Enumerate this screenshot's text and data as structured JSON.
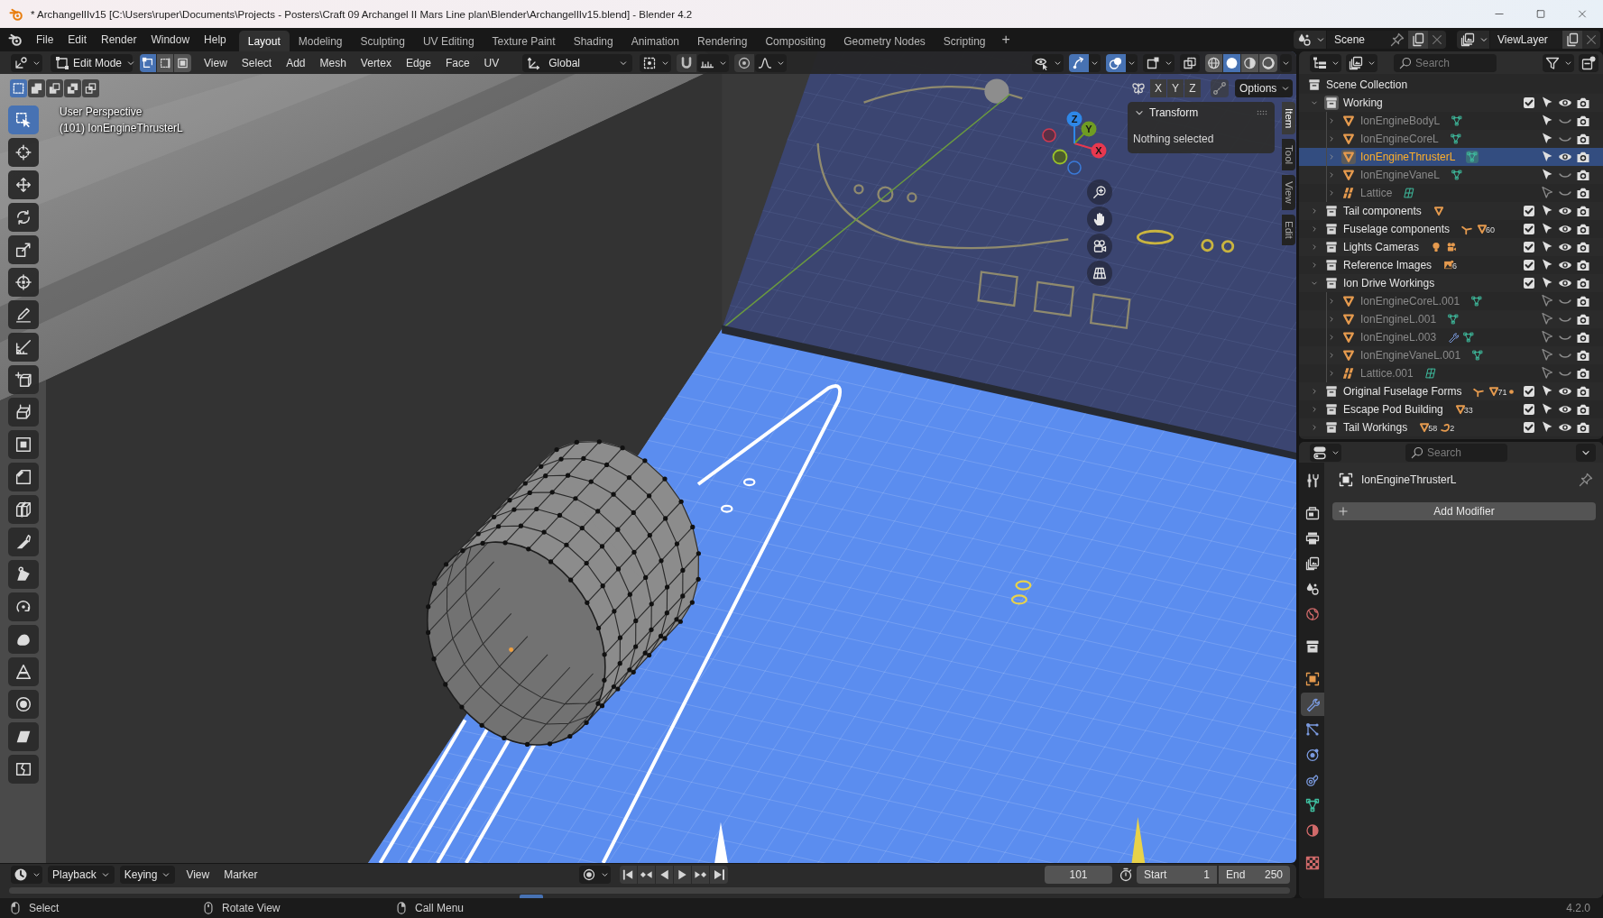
{
  "window": {
    "title": "* ArchangelIIv15 [C:\\Users\\ruper\\Documents\\Projects - Posters\\Craft 09 Archangel II Mars Line plan\\Blender\\ArchangelIIv15.blend] - Blender 4.2"
  },
  "top_bar": {
    "menu": [
      "File",
      "Edit",
      "Render",
      "Window",
      "Help"
    ],
    "workspaces": [
      {
        "label": "Layout",
        "selected": true
      },
      {
        "label": "Modeling",
        "selected": false
      },
      {
        "label": "Sculpting",
        "selected": false
      },
      {
        "label": "UV Editing",
        "selected": false
      },
      {
        "label": "Texture Paint",
        "selected": false
      },
      {
        "label": "Shading",
        "selected": false
      },
      {
        "label": "Animation",
        "selected": false
      },
      {
        "label": "Rendering",
        "selected": false
      },
      {
        "label": "Compositing",
        "selected": false
      },
      {
        "label": "Geometry Nodes",
        "selected": false
      },
      {
        "label": "Scripting",
        "selected": false
      }
    ],
    "add_workspace": "+",
    "scene": "Scene",
    "view_layer": "ViewLayer"
  },
  "viewport": {
    "header": {
      "mode": "Edit Mode",
      "select_modes": [
        {
          "kind": "vertex",
          "selected": true
        },
        {
          "kind": "edge",
          "selected": false
        },
        {
          "kind": "face",
          "selected": false
        }
      ],
      "menus": [
        "View",
        "Select",
        "Add",
        "Mesh",
        "Vertex",
        "Edge",
        "Face",
        "UV"
      ],
      "orientation": "Global",
      "snapping": {
        "on": false
      },
      "proportional_editing": {
        "on": false
      },
      "display_toggles": [
        {
          "kind": "visibility",
          "on": false
        },
        {
          "kind": "gizmo",
          "on": true
        },
        {
          "kind": "overlay",
          "on": true
        },
        {
          "kind": "mesh-overlay",
          "on": false
        },
        {
          "kind": "xray",
          "on": false
        }
      ],
      "shading": [
        {
          "kind": "wireframe",
          "selected": false
        },
        {
          "kind": "solid",
          "selected": true
        },
        {
          "kind": "material",
          "selected": false
        },
        {
          "kind": "rendered",
          "selected": false
        }
      ]
    },
    "select_box_modes": [
      {
        "kind": "set",
        "selected": true
      },
      {
        "kind": "extend",
        "selected": false
      },
      {
        "kind": "subtract",
        "selected": false
      },
      {
        "kind": "invert",
        "selected": false
      },
      {
        "kind": "intersect",
        "selected": false
      }
    ],
    "mirror_axes": [
      {
        "label": "X",
        "on": false
      },
      {
        "label": "Y",
        "on": false
      },
      {
        "label": "Z",
        "on": false
      }
    ],
    "options": "Options",
    "info": {
      "view": "User Perspective",
      "object": "(101) IonEngineThrusterL"
    },
    "toolbar": [
      {
        "kind": "select-box",
        "selected": true
      },
      {
        "kind": "cursor",
        "selected": false
      },
      {
        "kind": "move",
        "selected": false
      },
      {
        "kind": "rotate",
        "selected": false
      },
      {
        "kind": "scale",
        "selected": false
      },
      {
        "kind": "transform",
        "selected": false
      },
      {
        "kind": "annotate",
        "selected": false
      },
      {
        "kind": "measure",
        "selected": false
      },
      {
        "kind": "add-cube",
        "selected": false
      },
      {
        "kind": "extrude",
        "selected": false
      },
      {
        "kind": "inset",
        "selected": false
      },
      {
        "kind": "bevel",
        "selected": false
      },
      {
        "kind": "loop-cut",
        "selected": false
      },
      {
        "kind": "knife",
        "selected": false
      },
      {
        "kind": "poly-build",
        "selected": false
      },
      {
        "kind": "spin",
        "selected": false
      },
      {
        "kind": "smooth",
        "selected": false
      },
      {
        "kind": "edge-slide",
        "selected": false
      },
      {
        "kind": "shrink-fatten",
        "selected": false
      },
      {
        "kind": "shear",
        "selected": false
      },
      {
        "kind": "rip",
        "selected": false
      }
    ],
    "nav_gizmo": {
      "axes": [
        "X",
        "Y",
        "Z"
      ]
    },
    "sidebar": {
      "tabs": [
        {
          "label": "Item",
          "selected": true
        },
        {
          "label": "Tool",
          "selected": false
        },
        {
          "label": "View",
          "selected": false
        },
        {
          "label": "Edit",
          "selected": false
        }
      ],
      "panel": {
        "title": "Transform",
        "expanded": true,
        "message": "Nothing selected"
      }
    }
  },
  "outliner": {
    "search": {
      "placeholder": "Search"
    },
    "tree": {
      "name": "Scene Collection",
      "children": [
        {
          "name": "Working",
          "expanded": true,
          "active": true,
          "checked": true,
          "selectable": true,
          "visible": true,
          "selected": false,
          "children": [
            {
              "name": "IonEngineBodyL",
              "kind": "mesh",
              "expanded": false,
              "selectable": true,
              "visible": false,
              "selected": false,
              "data": [
                {
                  "kind": "mesh-data"
                }
              ]
            },
            {
              "name": "IonEngineCoreL",
              "kind": "mesh",
              "expanded": false,
              "selectable": true,
              "visible": false,
              "selected": false,
              "data": [
                {
                  "kind": "mesh-data"
                }
              ]
            },
            {
              "name": "IonEngineThrusterL",
              "kind": "mesh",
              "expanded": false,
              "selectable": true,
              "visible": true,
              "selected": true,
              "data": [
                {
                  "kind": "mesh-data"
                }
              ]
            },
            {
              "name": "IonEngineVaneL",
              "kind": "mesh",
              "expanded": false,
              "selectable": true,
              "visible": false,
              "selected": false,
              "data": [
                {
                  "kind": "mesh-data"
                }
              ]
            },
            {
              "name": "Lattice",
              "kind": "lattice",
              "expanded": false,
              "selectable": false,
              "visible": false,
              "selected": false,
              "data": [
                {
                  "kind": "lattice-data"
                }
              ]
            }
          ]
        },
        {
          "name": "Tail components",
          "expanded": false,
          "active": false,
          "checked": true,
          "selectable": true,
          "visible": true,
          "selected": false,
          "contents": [
            {
              "kind": "mesh"
            }
          ]
        },
        {
          "name": "Fuselage components",
          "expanded": false,
          "active": false,
          "checked": true,
          "selectable": true,
          "visible": true,
          "selected": false,
          "contents": [
            {
              "kind": "empty"
            },
            {
              "kind": "mesh",
              "count": "60"
            }
          ]
        },
        {
          "name": "Lights Cameras",
          "expanded": false,
          "active": false,
          "checked": true,
          "selectable": true,
          "visible": true,
          "selected": false,
          "contents": [
            {
              "kind": "light"
            },
            {
              "kind": "camera"
            }
          ]
        },
        {
          "name": "Reference Images",
          "expanded": false,
          "active": false,
          "checked": true,
          "selectable": true,
          "visible": true,
          "selected": false,
          "contents": [
            {
              "kind": "image",
              "count": "6"
            }
          ]
        },
        {
          "name": "Ion Drive Workings",
          "expanded": true,
          "active": false,
          "checked": true,
          "selectable": true,
          "visible": true,
          "selected": false,
          "children": [
            {
              "name": "IonEngineCoreL.001",
              "kind": "mesh",
              "expanded": false,
              "selectable": false,
              "visible": false,
              "selected": false,
              "data": [
                {
                  "kind": "mesh-data"
                }
              ]
            },
            {
              "name": "IonEngineL.001",
              "kind": "mesh",
              "expanded": false,
              "selectable": false,
              "visible": false,
              "selected": false,
              "data": [
                {
                  "kind": "mesh-data"
                }
              ]
            },
            {
              "name": "IonEngineL.003",
              "kind": "mesh",
              "expanded": false,
              "selectable": false,
              "visible": false,
              "selected": false,
              "data": [
                {
                  "kind": "modifier"
                },
                {
                  "kind": "mesh-data"
                }
              ]
            },
            {
              "name": "IonEngineVaneL.001",
              "kind": "mesh",
              "expanded": false,
              "selectable": false,
              "visible": false,
              "selected": false,
              "data": [
                {
                  "kind": "mesh-data"
                }
              ]
            },
            {
              "name": "Lattice.001",
              "kind": "lattice",
              "expanded": false,
              "selectable": false,
              "visible": false,
              "selected": false,
              "data": [
                {
                  "kind": "lattice-data"
                }
              ]
            }
          ]
        },
        {
          "name": "Original Fuselage Forms",
          "expanded": false,
          "active": false,
          "checked": true,
          "selectable": true,
          "visible": true,
          "selected": false,
          "contents": [
            {
              "kind": "empty"
            },
            {
              "kind": "mesh",
              "count": "71"
            },
            {
              "kind": "more"
            }
          ]
        },
        {
          "name": "Escape Pod Building",
          "expanded": false,
          "active": false,
          "checked": true,
          "selectable": true,
          "visible": true,
          "selected": false,
          "contents": [
            {
              "kind": "mesh",
              "count": "33"
            }
          ]
        },
        {
          "name": "Tail Workings",
          "expanded": false,
          "active": false,
          "checked": true,
          "selectable": true,
          "visible": true,
          "selected": false,
          "contents": [
            {
              "kind": "mesh",
              "count": "58"
            },
            {
              "kind": "curve",
              "count": "2"
            }
          ]
        }
      ]
    }
  },
  "properties": {
    "search": {
      "placeholder": "Search"
    },
    "tabs": [
      {
        "kind": "tool",
        "selected": false
      },
      {
        "kind": "render",
        "selected": false
      },
      {
        "kind": "output",
        "selected": false
      },
      {
        "kind": "view-layer",
        "selected": false
      },
      {
        "kind": "scene",
        "selected": false
      },
      {
        "kind": "world",
        "selected": false
      },
      {
        "kind": "collection",
        "selected": false
      },
      {
        "kind": "object",
        "selected": false
      },
      {
        "kind": "modifiers",
        "selected": true
      },
      {
        "kind": "particles",
        "selected": false
      },
      {
        "kind": "physics",
        "selected": false
      },
      {
        "kind": "constraints",
        "selected": false
      },
      {
        "kind": "data",
        "selected": false
      },
      {
        "kind": "material",
        "selected": false
      },
      {
        "kind": "texture",
        "selected": false
      }
    ],
    "object": "IonEngineThrusterL",
    "add_modifier": "Add Modifier"
  },
  "timeline": {
    "menus": [
      {
        "label": "Playback",
        "kind": "dropdown"
      },
      {
        "label": "Keying",
        "kind": "dropdown"
      },
      {
        "label": "View",
        "kind": "menu"
      },
      {
        "label": "Marker",
        "kind": "menu"
      }
    ],
    "auto_keying": {
      "on": false
    },
    "preview_range": {
      "on": false
    },
    "current_frame": "101",
    "start": {
      "label": "Start",
      "value": "1"
    },
    "end": {
      "label": "End",
      "value": "250"
    }
  },
  "status_bar": {
    "hints": [
      {
        "kind": "left",
        "label": "Select"
      },
      {
        "kind": "middle",
        "label": "Rotate View"
      },
      {
        "kind": "right",
        "label": "Call Menu"
      }
    ],
    "version": "4.2.0"
  }
}
